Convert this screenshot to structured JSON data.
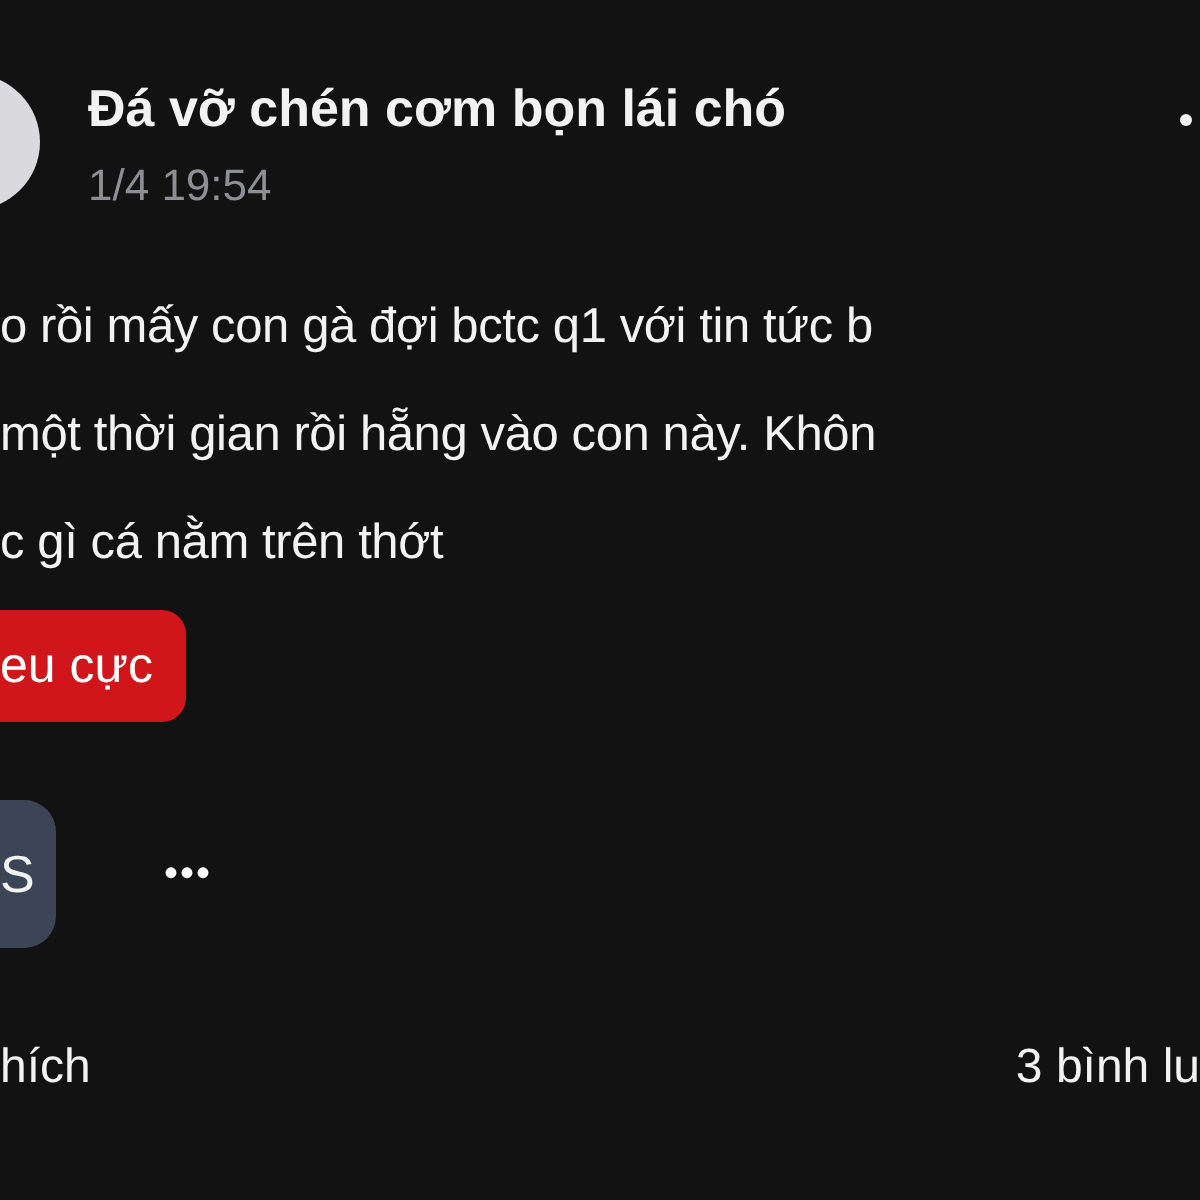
{
  "post": {
    "author": "Đá vỡ chén cơm bọn lái chó",
    "time": "1/4 19:54",
    "body_lines": [
      "o rồi mấy con gà đợi bctc q1 với tin tức b",
      "một thời gian rồi hẵng vào con này. Khôn",
      "c gì cá nằm trên thớt"
    ],
    "tag": {
      "label": "eu cực",
      "color": "#d0161b"
    },
    "reaction_button": {
      "label": "S"
    },
    "more": "•••"
  },
  "footer": {
    "likes": "hích",
    "comments": "3 bình lu"
  }
}
